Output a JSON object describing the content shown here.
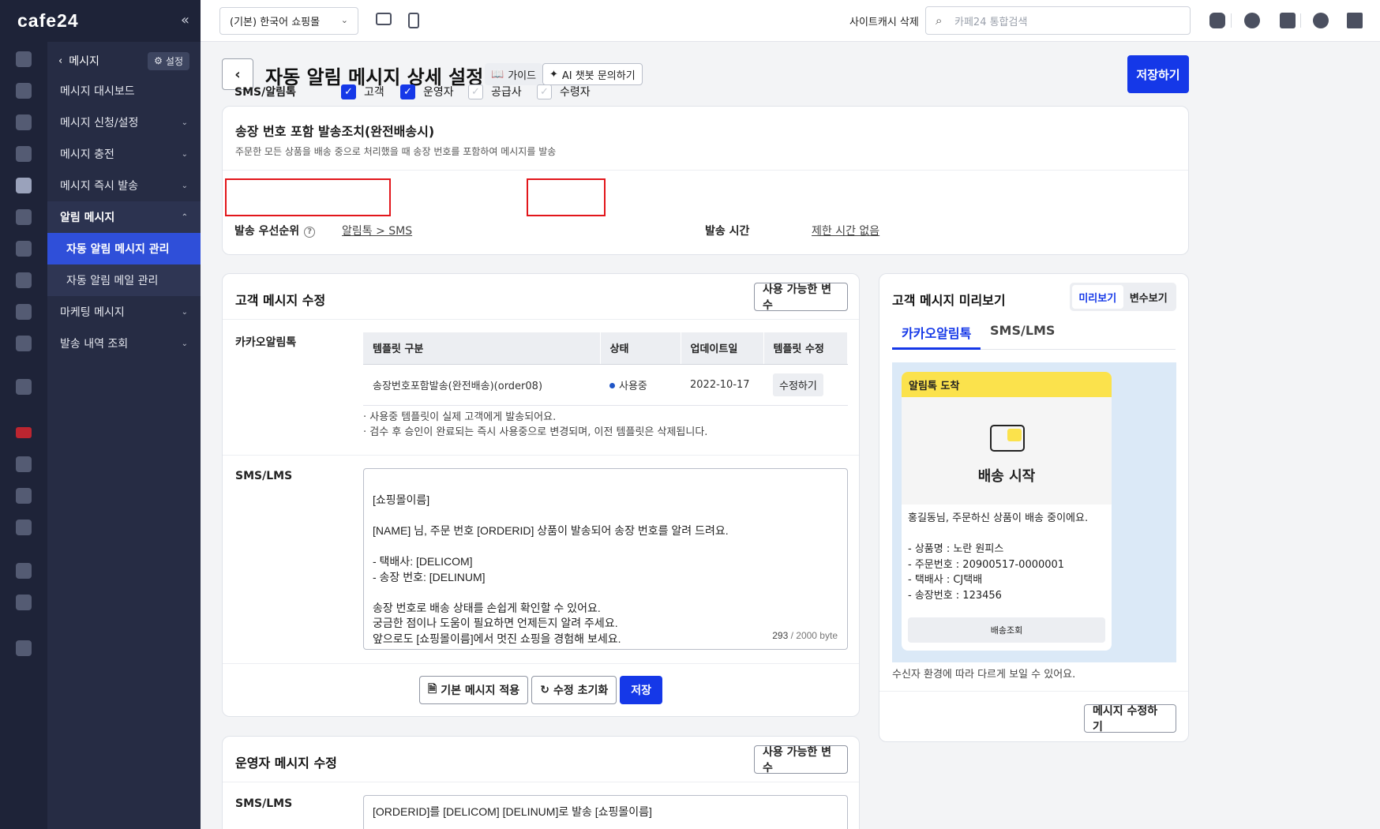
{
  "brand": {
    "logo": "cafe24",
    "collapse": "«"
  },
  "sidebar": {
    "back_label": "메시지",
    "setting_label": "설정",
    "items": [
      {
        "label": "메시지 대시보드",
        "chevron": ""
      },
      {
        "label": "메시지 신청/설정",
        "chevron": "⌄"
      },
      {
        "label": "메시지 충전",
        "chevron": "⌄"
      },
      {
        "label": "메시지 즉시 발송",
        "chevron": "⌄"
      },
      {
        "label": "알림 메시지",
        "chevron": "⌃"
      },
      {
        "label": "마케팅 메시지",
        "chevron": "⌄"
      },
      {
        "label": "발송 내역 조회",
        "chevron": "⌄"
      }
    ],
    "subitems": [
      {
        "label": "자동 알림 메시지 관리"
      },
      {
        "label": "자동 알림 메일 관리"
      }
    ]
  },
  "topbar": {
    "mall_select": "(기본) 한국어 쇼핑몰",
    "cache_link": "사이트캐시 삭제",
    "search_placeholder": "카페24 통합검색"
  },
  "header": {
    "title": "자동 알림 메시지 상세 설정",
    "guide_label": "가이드",
    "ai_label": "AI 챗봇 문의하기",
    "save_label": "저장하기"
  },
  "send_config": {
    "title": "송장 번호 포함 발송조치(완전배송시)",
    "description": "주문한 모든 상품을 배송 중으로 처리했을 때 송장 번호를 포함하여 메시지를 발송",
    "channel_label": "SMS/알림톡",
    "recipients": [
      {
        "label": "고객",
        "checked": true
      },
      {
        "label": "운영자",
        "checked": true
      },
      {
        "label": "공급사",
        "checked": false
      },
      {
        "label": "수령자",
        "checked": false
      }
    ],
    "priority_label": "발송 우선순위",
    "priority_value": "알림톡 > SMS",
    "time_label": "발송 시간",
    "time_value": "제한 시간 없음"
  },
  "customer_message": {
    "title": "고객 메시지 수정",
    "variables_button": "사용 가능한 변수",
    "kakao_label": "카카오알림톡",
    "table_headers": [
      "템플릿 구분",
      "상태",
      "업데이트일",
      "템플릿 수정"
    ],
    "table_rows": [
      {
        "template": "송장번호포함발송(완전배송)(order08)",
        "status": "사용중",
        "updated": "2022-10-17",
        "action": "수정하기"
      }
    ],
    "notes": [
      "· 사용중 템플릿이 실제 고객에게 발송되어요.",
      "· 검수 후 승인이 완료되는 즉시 사용중으로 변경되며, 이전 템플릿은 삭제됩니다."
    ],
    "sms_label": "SMS/LMS",
    "sms_text": "[쇼핑몰이름]\n\n[NAME] 님, 주문 번호 [ORDERID] 상품이 발송되어 송장 번호를 알려 드려요.\n\n- 택배사: [DELICOM]\n- 송장 번호: [DELINUM]\n\n송장 번호로 배송 상태를 손쉽게 확인할 수 있어요.\n궁금한 점이나 도움이 필요하면 언제든지 알려 주세요.\n앞으로도 [쇼핑몰이름]에서 멋진 쇼핑을 경험해 보세요.",
    "byte_used": "293",
    "byte_total": "/ 2000 byte",
    "apply_default": "기본 메시지 적용",
    "reset": "수정 초기화",
    "save": "저장"
  },
  "operator_message": {
    "title": "운영자 메시지 수정",
    "variables_button": "사용 가능한 변수",
    "sms_label": "SMS/LMS",
    "sms_text": "[ORDERID]를 [DELICOM] [DELINUM]로 발송 [쇼핑몰이름]"
  },
  "preview": {
    "title": "고객 메시지 미리보기",
    "toggle": [
      "미리보기",
      "변수보기"
    ],
    "tabs": [
      "카카오알림톡",
      "SMS/LMS"
    ],
    "bubble_header": "알림톡 도착",
    "hero_text": "배송 시작",
    "body": "홍길동님, 주문하신 상품이 배송 중이에요.\n\n- 상품명 : 노란 원피스\n- 주문번호 : 20900517-0000001\n- 택배사 : CJ택배\n- 송장번호 : 123456",
    "track_button": "배송조회",
    "note": "수신자 환경에 따라 다르게 보일 수 있어요.",
    "edit_button": "메시지 수정하기"
  }
}
